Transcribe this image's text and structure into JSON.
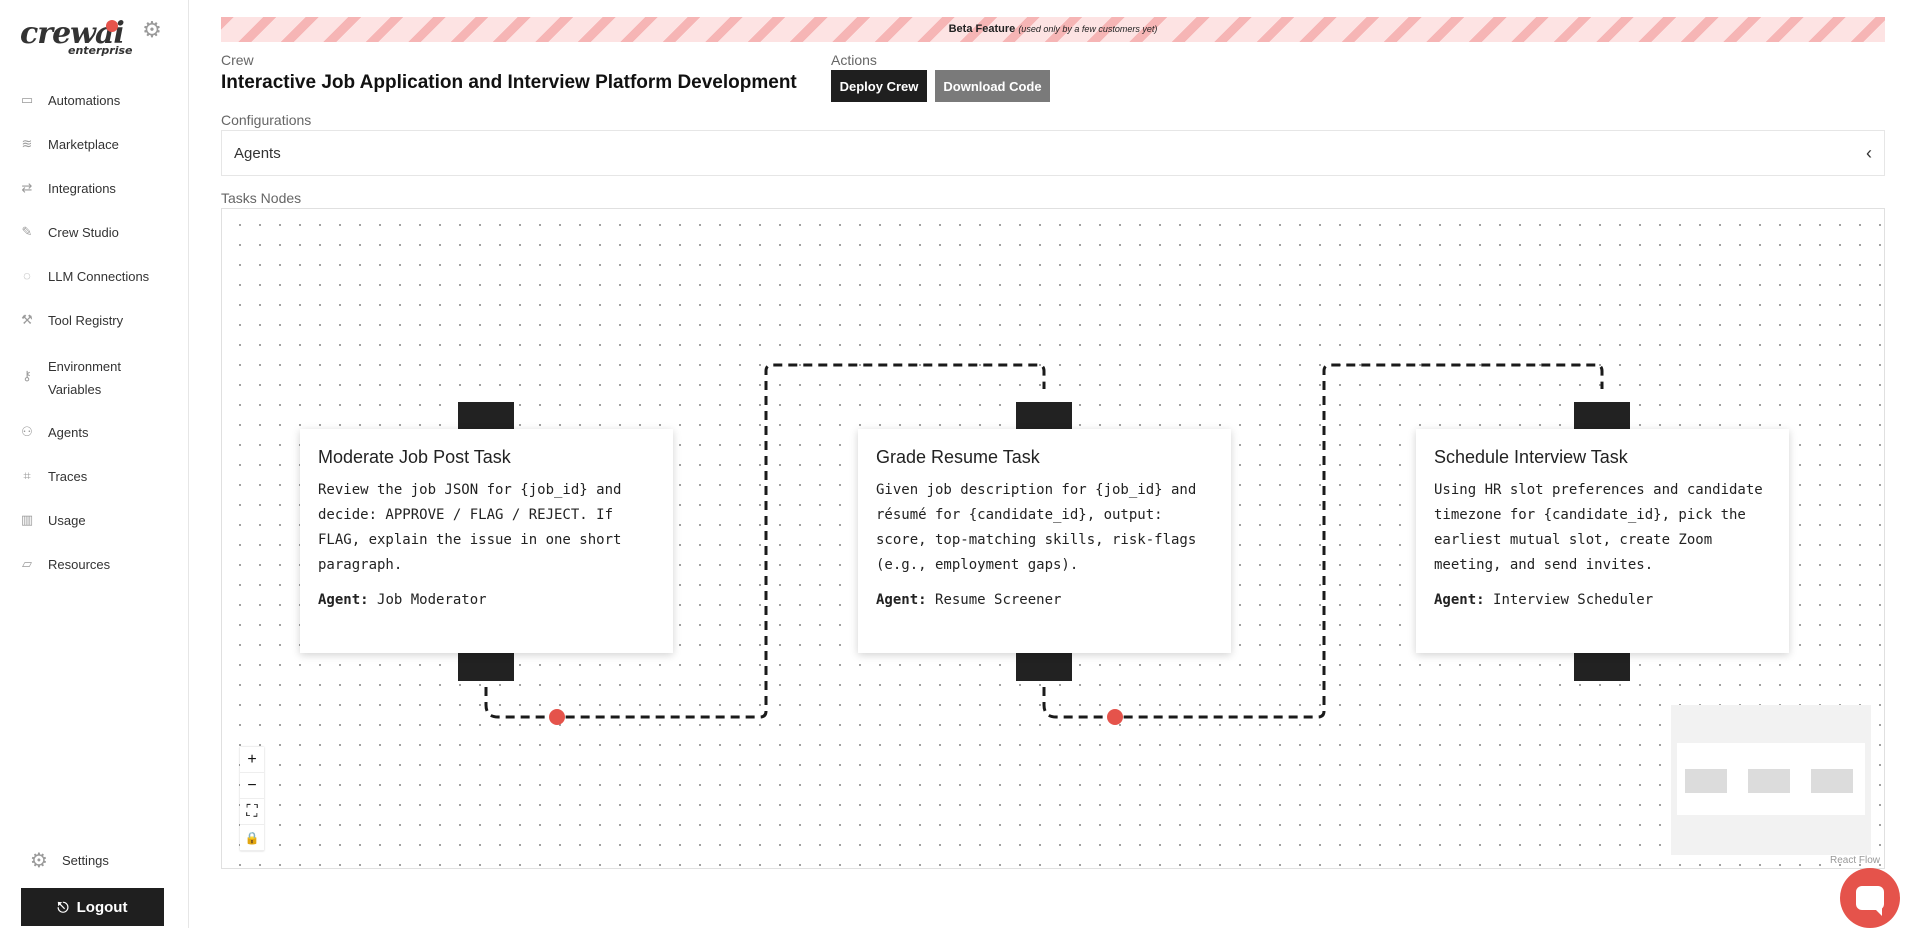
{
  "sidebar": {
    "logo_text": "crewai",
    "logo_sub": "enterprise",
    "items": [
      {
        "label": "Automations",
        "icon": "monitor-icon"
      },
      {
        "label": "Marketplace",
        "icon": "database-icon"
      },
      {
        "label": "Integrations",
        "icon": "arrows-icon"
      },
      {
        "label": "Crew Studio",
        "icon": "edit-icon"
      },
      {
        "label": "LLM Connections",
        "icon": "circle-icon"
      },
      {
        "label": "Tool Registry",
        "icon": "wrench-icon"
      },
      {
        "label": "Environment Variables",
        "icon": "key-icon"
      },
      {
        "label": "Agents",
        "icon": "users-icon"
      },
      {
        "label": "Traces",
        "icon": "scan-icon"
      },
      {
        "label": "Usage",
        "icon": "bar-chart-icon"
      },
      {
        "label": "Resources",
        "icon": "folder-icon"
      }
    ],
    "settings_label": "Settings",
    "logout_label": "Logout"
  },
  "banner": {
    "title": "Beta Feature",
    "note": "(used only by a few customers yet)"
  },
  "header": {
    "crew_label": "Crew",
    "crew_title": "Interactive Job Application and Interview Platform Development",
    "actions_label": "Actions",
    "deploy_label": "Deploy Crew",
    "download_label": "Download Code"
  },
  "config": {
    "label": "Configurations",
    "agents_label": "Agents"
  },
  "tasks": {
    "label": "Tasks Nodes",
    "nodes": [
      {
        "title": "Moderate Job Post Task",
        "description": "Review the job JSON for {job_id} and decide: APPROVE / FLAG / REJECT. If FLAG, explain the issue in one short paragraph.",
        "agent_label": "Agent:",
        "agent": "Job Moderator"
      },
      {
        "title": "Grade Resume Task",
        "description": "Given job description for {job_id} and résumé for {candidate_id}, output: score, top-matching skills, risk-flags (e.g., employment gaps).",
        "agent_label": "Agent:",
        "agent": "Resume Screener"
      },
      {
        "title": "Schedule Interview Task",
        "description": "Using HR slot preferences and candidate timezone for {candidate_id}, pick the earliest mutual slot, create Zoom meeting, and send invites.",
        "agent_label": "Agent:",
        "agent": "Interview Scheduler"
      }
    ],
    "attribution": "React Flow"
  },
  "colors": {
    "accent": "#e5534b",
    "dark": "#1f1f1f"
  }
}
